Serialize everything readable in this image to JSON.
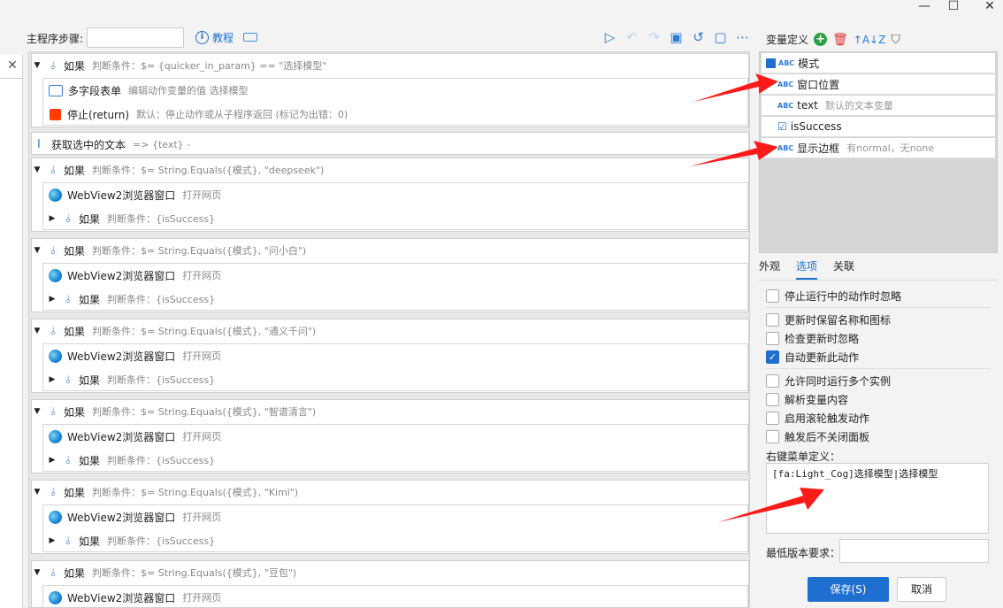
{
  "window": {
    "minimize": "—",
    "maximize": "☐",
    "close": "✕"
  },
  "toolbar": {
    "step_label": "主程序步骤:",
    "step_value": "",
    "tutorial": "教程"
  },
  "left_strip": {
    "close": "✕"
  },
  "blocks": [
    {
      "kw": "如果",
      "cond": "判断条件：$= {quicker_in_param} == \"选择模型\"",
      "children": [
        {
          "kw": "多字段表单",
          "cond": "编辑动作变量的值 选择模型"
        },
        {
          "kw": "停止(return)",
          "cond": "默认：停止动作或从子程序返回 (标记为出错：0)"
        }
      ]
    },
    {
      "kw": "获取选中的文本",
      "cond": "=> {text} -"
    },
    {
      "kw": "如果",
      "cond": "判断条件：$= String.Equals({模式}, \"deepseek\")",
      "children": [
        {
          "kw": "WebView2浏览器窗口",
          "cond": "打开网页"
        },
        {
          "kw": "如果",
          "cond": "判断条件：{isSuccess}"
        }
      ]
    },
    {
      "kw": "如果",
      "cond": "判断条件：$= String.Equals({模式}, \"问小白\")",
      "children": [
        {
          "kw": "WebView2浏览器窗口",
          "cond": "打开网页"
        },
        {
          "kw": "如果",
          "cond": "判断条件：{isSuccess}"
        }
      ]
    },
    {
      "kw": "如果",
      "cond": "判断条件：$= String.Equals({模式}, \"通义千问\")",
      "children": [
        {
          "kw": "WebView2浏览器窗口",
          "cond": "打开网页"
        },
        {
          "kw": "如果",
          "cond": "判断条件：{isSuccess}"
        }
      ]
    },
    {
      "kw": "如果",
      "cond": "判断条件：$= String.Equals({模式}, \"智谱清言\")",
      "children": [
        {
          "kw": "WebView2浏览器窗口",
          "cond": "打开网页"
        },
        {
          "kw": "如果",
          "cond": "判断条件：{isSuccess}"
        }
      ]
    },
    {
      "kw": "如果",
      "cond": "判断条件：$= String.Equals({模式}, \"Kimi\")",
      "children": [
        {
          "kw": "WebView2浏览器窗口",
          "cond": "打开网页"
        },
        {
          "kw": "如果",
          "cond": "判断条件：{isSuccess}"
        }
      ]
    },
    {
      "kw": "如果",
      "cond": "判断条件：$= String.Equals({模式}, \"豆包\")",
      "children": [
        {
          "kw": "WebView2浏览器窗口",
          "cond": "打开网页"
        }
      ]
    }
  ],
  "variables": {
    "header": "变量定义",
    "items": [
      {
        "type": "ABC",
        "name": "模式",
        "desc": ""
      },
      {
        "type": "ABC",
        "name": "窗口位置",
        "desc": ""
      },
      {
        "type": "ABC",
        "name": "text",
        "desc": "默认的文本变量"
      },
      {
        "type": "☑",
        "name": "isSuccess",
        "desc": ""
      },
      {
        "type": "ABC",
        "name": "显示边框",
        "desc": "有normal，无none"
      }
    ]
  },
  "tabs": [
    "外观",
    "选项",
    "关联"
  ],
  "options": [
    {
      "label": "停止运行中的动作时忽略",
      "checked": false
    },
    {
      "label": "更新时保留名称和图标",
      "checked": false
    },
    {
      "label": "检查更新时忽略",
      "checked": false
    },
    {
      "label": "自动更新此动作",
      "checked": true
    },
    {
      "label": "允许同时运行多个实例",
      "checked": false
    },
    {
      "label": "解析变量内容",
      "checked": false
    },
    {
      "label": "启用滚轮触发动作",
      "checked": false
    },
    {
      "label": "触发后不关闭面板",
      "checked": false
    }
  ],
  "context_menu": {
    "label": "右键菜单定义：",
    "value": "[fa:Light_Cog]选择模型|选择模型"
  },
  "min_version": {
    "label": "最低版本要求：",
    "value": ""
  },
  "buttons": {
    "save": "保存(S)",
    "cancel": "取消"
  },
  "colors": {
    "accent": "#1f6fd1",
    "arrow": "#ff1a1a",
    "stop": "#ff3b00"
  }
}
